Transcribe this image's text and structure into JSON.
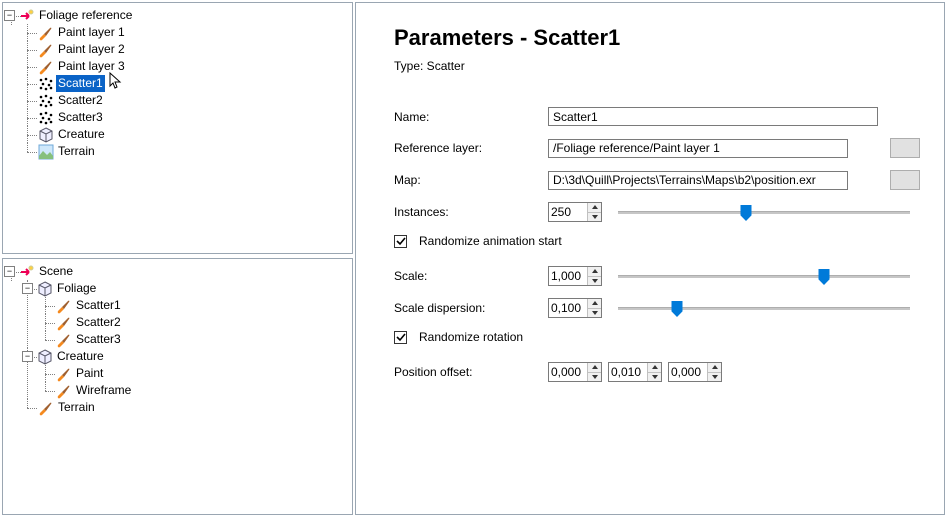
{
  "tree_top": {
    "root": {
      "label": "Foliage reference",
      "children": [
        {
          "label": "Paint layer 1"
        },
        {
          "label": "Paint layer 2"
        },
        {
          "label": "Paint layer 3"
        },
        {
          "label": "Scatter1",
          "selected": true
        },
        {
          "label": "Scatter2"
        },
        {
          "label": "Scatter3"
        },
        {
          "label": "Creature"
        },
        {
          "label": "Terrain"
        }
      ]
    }
  },
  "tree_bottom": {
    "root": {
      "label": "Scene",
      "children": [
        {
          "label": "Foliage",
          "children": [
            {
              "label": "Scatter1"
            },
            {
              "label": "Scatter2"
            },
            {
              "label": "Scatter3"
            }
          ]
        },
        {
          "label": "Creature",
          "children": [
            {
              "label": "Paint"
            },
            {
              "label": "Wireframe"
            }
          ]
        },
        {
          "label": "Terrain"
        }
      ]
    }
  },
  "params": {
    "title": "Parameters - Scatter1",
    "type_line": "Type: Scatter",
    "labels": {
      "name": "Name:",
      "ref_layer": "Reference layer:",
      "map": "Map:",
      "instances": "Instances:",
      "rand_anim": "Randomize animation start",
      "scale": "Scale:",
      "scale_disp": "Scale dispersion:",
      "rand_rot": "Randomize rotation",
      "pos_offset": "Position offset:"
    },
    "values": {
      "name": "Scatter1",
      "ref_layer": "/Foliage reference/Paint layer 1",
      "map": "D:\\3d\\Quill\\Projects\\Terrains\\Maps\\b2\\position.exr",
      "instances": "250",
      "rand_anim_checked": true,
      "scale": "1,000",
      "scale_disp": "0,100",
      "rand_rot_checked": true,
      "pos_offset": [
        "0,000",
        "0,010",
        "0,000"
      ]
    },
    "slider_pct": {
      "instances": 44,
      "scale": 70,
      "scale_disp": 21
    }
  }
}
